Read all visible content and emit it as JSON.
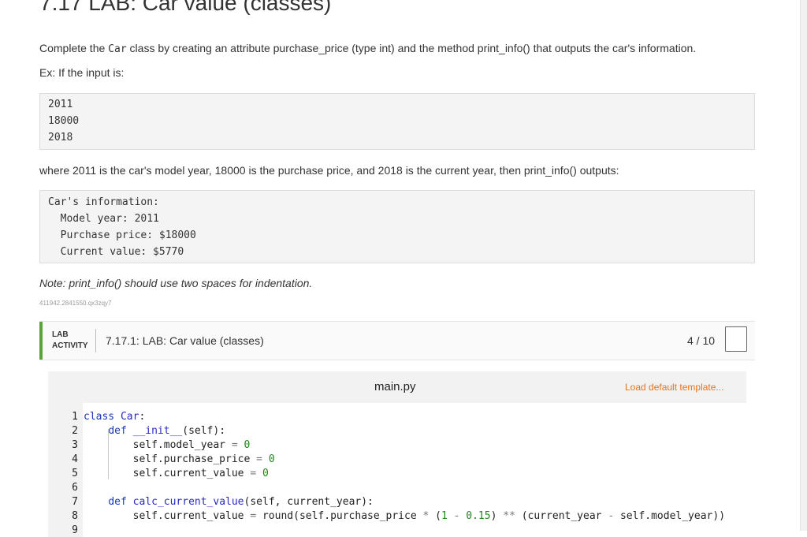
{
  "page": {
    "heading": "7.17 LAB: Car value (classes)",
    "intro_before": "Complete the ",
    "intro_code": "Car",
    "intro_after": " class by creating an attribute purchase_price (type int) and the method print_info() that outputs the car's information.",
    "example_label": "Ex: If the input is:",
    "input_lines": [
      "2011",
      "18000",
      "2018"
    ],
    "explanation": "where 2011 is the car's model year, 18000 is the purchase price, and 2018 is the current year, then print_info() outputs:",
    "output_lines": [
      "Car's information:",
      "  Model year: 2011",
      "  Purchase price: $18000",
      "  Current value: $5770"
    ],
    "note": "Note: print_info() should use two spaces for indentation.",
    "id_text": "411942.2841550.qx3zqy7"
  },
  "lab": {
    "badge_line1": "LAB",
    "badge_line2": "ACTIVITY",
    "title": "7.17.1: LAB: Car value (classes)",
    "score": "4 / 10",
    "accent_color": "#5aa33a"
  },
  "editor": {
    "filename": "main.py",
    "load_default": "Load default template...",
    "line_numbers": [
      "1",
      "2",
      "3",
      "4",
      "5",
      "6",
      "7",
      "8",
      "9"
    ],
    "lines": [
      "class Car:",
      "    def __init__(self):",
      "        self.model_year = 0",
      "        self.purchase_price = 0",
      "        self.current_value = 0",
      "",
      "    def calc_current_value(self, current_year):",
      "        self.current_value = round(self.purchase_price * (1 - 0.15) ** (current_year - self.model_year))",
      ""
    ]
  }
}
